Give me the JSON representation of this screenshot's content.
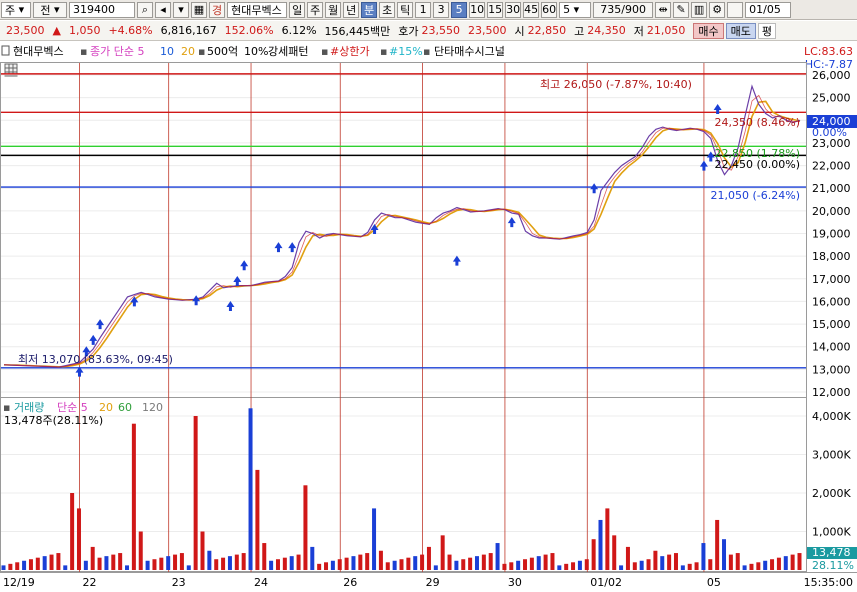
{
  "toolbar": {
    "market": "주",
    "prev_label": "전",
    "code": "319400",
    "badge": "경",
    "name": "현대무벡스",
    "periods": [
      "일",
      "주",
      "월",
      "년",
      "분",
      "초",
      "틱"
    ],
    "active_period": "분",
    "minutes": [
      "1",
      "3",
      "5",
      "10",
      "15",
      "30",
      "45",
      "60"
    ],
    "active_minute": "5",
    "minute_select": "5",
    "count": "735/900",
    "date": "01/05"
  },
  "quote": {
    "price": "23,500",
    "change": "1,050",
    "change_pct": "+4.68%",
    "volume": "6,816,167",
    "volume_ratio": "152.06%",
    "turnover_pct": "6.12%",
    "amount": "156,445백만",
    "ask_label": "호가",
    "ask": "23,550",
    "bid": "23,500",
    "open_label": "시",
    "open": "22,850",
    "high_label": "고",
    "high": "24,350",
    "low_label": "저",
    "low": "21,050",
    "buy_label": "매수",
    "sell_label": "매도",
    "eval_label": "평"
  },
  "legend": {
    "name": "현대무벡스",
    "ma_label": "종가 단순 5",
    "ma10": "10",
    "ma20": "20",
    "value": "500억",
    "pct10": "10%",
    "pattern": "강세패턴",
    "limit": "#상한가",
    "p15": "#15%",
    "signal": "단타매수시그널",
    "lc": "LC:83.63",
    "hc": "HC:-7.87"
  },
  "volume_legend": {
    "title": "거래량",
    "ma": "단순 5",
    "ma20": "20",
    "ma60": "60",
    "ma120": "120",
    "value": "13,478주(28.11%)"
  },
  "colors": {
    "up": "#d01818",
    "down": "#1a3fd6",
    "ma5": "#d43fbf",
    "ma10": "#1a5bd6",
    "ma20": "#e0a010",
    "ma60": "#2f9e3a",
    "ma120": "#7a7a7a"
  },
  "chart_data": {
    "type": "line",
    "price_axis": {
      "ticks": [
        "26,000",
        "25,000",
        "24,000",
        "23,000",
        "22,000",
        "21,000",
        "20,000",
        "19,000",
        "18,000",
        "17,000",
        "16,000",
        "15,000",
        "14,000",
        "13,000",
        "12,000"
      ],
      "values": [
        26000,
        25000,
        24000,
        23000,
        22000,
        21000,
        20000,
        19000,
        18000,
        17000,
        16000,
        15000,
        14000,
        13000,
        12000
      ],
      "current": "24,000",
      "current_pct": "0.00%"
    },
    "volume_axis": {
      "ticks": [
        "4,000K",
        "3,000K",
        "2,000K",
        "1,000K"
      ],
      "values": [
        4000000,
        3000000,
        2000000,
        1000000
      ],
      "current": "13,478",
      "current_pct": "28.11%"
    },
    "x_labels": [
      "12/19",
      "22",
      "23",
      "24",
      "26",
      "29",
      "30",
      "01/02",
      "05"
    ],
    "time_label": "15:35:00",
    "annotations": {
      "high": "최고 26,050 (-7.87%, 10:40)",
      "low": "최저 13,070 (83.63%, 09:45)",
      "l1": "24,350 (8.46%)",
      "l2": "22,850 (1.78%)",
      "l3": "22,450 (0.00%)",
      "l4": "21,050 (-6.24%)"
    },
    "levels": [
      {
        "value": 26050,
        "color": "#d01818"
      },
      {
        "value": 24350,
        "color": "#d01818"
      },
      {
        "value": 22850,
        "color": "#2fd02f"
      },
      {
        "value": 22450,
        "color": "#000000"
      },
      {
        "value": 21050,
        "color": "#1a3fd6"
      },
      {
        "value": 13070,
        "color": "#1a3fd6"
      }
    ],
    "day_breaks": [
      22,
      23,
      24,
      26,
      29,
      30,
      1,
      5
    ],
    "price_series": [
      [
        0,
        13200
      ],
      [
        4,
        13150
      ],
      [
        8,
        13100
      ],
      [
        11,
        13300
      ],
      [
        13,
        13900
      ],
      [
        14,
        14400
      ],
      [
        16,
        15300
      ],
      [
        18,
        16200
      ],
      [
        20,
        16400
      ],
      [
        22,
        16200
      ],
      [
        24,
        16100
      ],
      [
        26,
        16050
      ],
      [
        28,
        16100
      ],
      [
        29,
        16200
      ],
      [
        30,
        16500
      ],
      [
        31,
        16800
      ],
      [
        32,
        16600
      ],
      [
        34,
        16700
      ],
      [
        36,
        16700
      ],
      [
        38,
        16850
      ],
      [
        40,
        16900
      ],
      [
        41,
        17100
      ],
      [
        42,
        17500
      ],
      [
        43,
        18600
      ],
      [
        44,
        19100
      ],
      [
        45,
        19000
      ],
      [
        46,
        18800
      ],
      [
        47,
        18950
      ],
      [
        48,
        19000
      ],
      [
        50,
        18900
      ],
      [
        52,
        18850
      ],
      [
        53,
        19050
      ],
      [
        54,
        19600
      ],
      [
        55,
        19900
      ],
      [
        56,
        19800
      ],
      [
        57,
        19700
      ],
      [
        58,
        19700
      ],
      [
        60,
        19500
      ],
      [
        62,
        19400
      ],
      [
        63,
        19700
      ],
      [
        64,
        19900
      ],
      [
        65,
        20000
      ],
      [
        66,
        20150
      ],
      [
        67,
        20050
      ],
      [
        68,
        19950
      ],
      [
        70,
        20000
      ],
      [
        72,
        20100
      ],
      [
        73,
        20050
      ],
      [
        74,
        19900
      ],
      [
        75,
        19850
      ],
      [
        76,
        19100
      ],
      [
        77,
        18900
      ],
      [
        78,
        18800
      ],
      [
        79,
        18800
      ],
      [
        81,
        18750
      ],
      [
        83,
        18900
      ],
      [
        84,
        18950
      ],
      [
        85,
        19050
      ],
      [
        86,
        19600
      ],
      [
        87,
        20900
      ],
      [
        88,
        21300
      ],
      [
        89,
        21700
      ],
      [
        90,
        22000
      ],
      [
        91,
        22200
      ],
      [
        92,
        22400
      ],
      [
        93,
        22800
      ],
      [
        94,
        23300
      ],
      [
        95,
        23600
      ],
      [
        96,
        23700
      ],
      [
        97,
        23600
      ],
      [
        98,
        23550
      ],
      [
        99,
        23600
      ],
      [
        100,
        23650
      ],
      [
        101,
        23600
      ],
      [
        102,
        23500
      ],
      [
        103,
        23200
      ],
      [
        104,
        22200
      ],
      [
        105,
        21600
      ],
      [
        106,
        22000
      ],
      [
        107,
        22800
      ],
      [
        108,
        24200
      ],
      [
        109,
        25500
      ],
      [
        110,
        24700
      ],
      [
        111,
        24300
      ],
      [
        112,
        24100
      ],
      [
        113,
        24200
      ],
      [
        114,
        24000
      ],
      [
        115,
        23900
      ],
      [
        116,
        24000
      ]
    ],
    "up_markers": [
      [
        11,
        12900
      ],
      [
        12,
        13800
      ],
      [
        13,
        14300
      ],
      [
        14,
        15000
      ],
      [
        19,
        16000
      ],
      [
        28,
        16050
      ],
      [
        33,
        15800
      ],
      [
        34,
        16900
      ],
      [
        35,
        17600
      ],
      [
        40,
        18400
      ],
      [
        42,
        18400
      ],
      [
        54,
        19200
      ],
      [
        66,
        17800
      ],
      [
        74,
        19500
      ],
      [
        86,
        21000
      ],
      [
        102,
        22000
      ],
      [
        103,
        22400
      ],
      [
        104,
        24500
      ]
    ],
    "volume_series": [
      [
        10,
        2000000
      ],
      [
        11,
        1600000
      ],
      [
        13,
        600000
      ],
      [
        19,
        3800000
      ],
      [
        20,
        1000000
      ],
      [
        28,
        4000000
      ],
      [
        29,
        1000000
      ],
      [
        30,
        500000
      ],
      [
        36,
        4200000
      ],
      [
        37,
        2600000
      ],
      [
        38,
        700000
      ],
      [
        44,
        2200000
      ],
      [
        45,
        600000
      ],
      [
        54,
        1600000
      ],
      [
        55,
        500000
      ],
      [
        62,
        600000
      ],
      [
        64,
        900000
      ],
      [
        65,
        400000
      ],
      [
        72,
        700000
      ],
      [
        86,
        800000
      ],
      [
        87,
        1300000
      ],
      [
        88,
        1600000
      ],
      [
        89,
        900000
      ],
      [
        91,
        600000
      ],
      [
        95,
        500000
      ],
      [
        102,
        700000
      ],
      [
        104,
        1300000
      ],
      [
        105,
        800000
      ]
    ]
  }
}
